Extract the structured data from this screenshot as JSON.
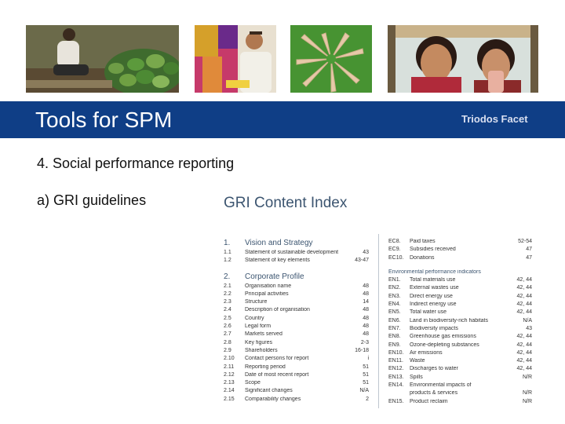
{
  "banner": {
    "title": "Tools for SPM",
    "logo": "Triodos Facet"
  },
  "heading": "4. Social performance reporting",
  "subheading": "a) GRI guidelines",
  "index_title": "GRI Content Index",
  "left_column": [
    {
      "type": "section",
      "num": "1.",
      "label": "Vision and Strategy"
    },
    {
      "num": "1.1",
      "label": "Statement of sustainable development",
      "page": "43"
    },
    {
      "num": "1.2",
      "label": "Statement of key elements",
      "page": "43-47"
    },
    {
      "type": "gap"
    },
    {
      "type": "section",
      "num": "2.",
      "label": "Corporate Profile"
    },
    {
      "num": "2.1",
      "label": "Organisation name",
      "page": "48"
    },
    {
      "num": "2.2",
      "label": "Principal activities",
      "page": "48"
    },
    {
      "num": "2.3",
      "label": "Structure",
      "page": "14"
    },
    {
      "num": "2.4",
      "label": "Description of organisation",
      "page": "48"
    },
    {
      "num": "2.5",
      "label": "Country",
      "page": "48"
    },
    {
      "num": "2.6",
      "label": "Legal form",
      "page": "48"
    },
    {
      "num": "2.7",
      "label": "Markets served",
      "page": "48"
    },
    {
      "num": "2.8",
      "label": "Key figures",
      "page": "2-3"
    },
    {
      "num": "2.9",
      "label": "Shareholders",
      "page": "16-18"
    },
    {
      "num": "2.10",
      "label": "Contact persons for report",
      "page": "i"
    },
    {
      "num": "2.11",
      "label": "Reporting period",
      "page": "51"
    },
    {
      "num": "2.12",
      "label": "Date of most recent report",
      "page": "51"
    },
    {
      "num": "2.13",
      "label": "Scope",
      "page": "51"
    },
    {
      "num": "2.14",
      "label": "Significant changes",
      "page": "N/A"
    },
    {
      "num": "2.15",
      "label": "Comparability changes",
      "page": "2"
    }
  ],
  "right_column": [
    {
      "num": "EC8.",
      "label": "Paid taxes",
      "page": "52-54"
    },
    {
      "num": "EC9.",
      "label": "Subsidies received",
      "page": "47"
    },
    {
      "num": "EC10.",
      "label": "Donations",
      "page": "47"
    },
    {
      "type": "gap"
    },
    {
      "type": "heading",
      "label": "Environmental performance indicators"
    },
    {
      "num": "EN1.",
      "label": "Total materials use",
      "page": "42, 44"
    },
    {
      "num": "EN2.",
      "label": "External wastes use",
      "page": "42, 44"
    },
    {
      "num": "EN3.",
      "label": "Direct energy use",
      "page": "42, 44"
    },
    {
      "num": "EN4.",
      "label": "Indirect energy use",
      "page": "42, 44"
    },
    {
      "num": "EN5.",
      "label": "Total water use",
      "page": "42, 44"
    },
    {
      "num": "EN6.",
      "label": "Land in biodiversity-rich habitats",
      "page": "N/A"
    },
    {
      "num": "EN7.",
      "label": "Biodiversity impacts",
      "page": "43"
    },
    {
      "num": "EN8.",
      "label": "Greenhouse gas emissions",
      "page": "42, 44"
    },
    {
      "num": "EN9.",
      "label": "Ozone-depleting substances",
      "page": "42, 44"
    },
    {
      "num": "EN10.",
      "label": "Air emissions",
      "page": "42, 44"
    },
    {
      "num": "EN11.",
      "label": "Waste",
      "page": "42, 44"
    },
    {
      "num": "EN12.",
      "label": "Discharges to water",
      "page": "42, 44"
    },
    {
      "num": "EN13.",
      "label": "Spills",
      "page": "N/R"
    },
    {
      "num": "EN14.",
      "label": "Environmental impacts of",
      "page": ""
    },
    {
      "num": "",
      "label": "products & services",
      "page": "N/R"
    },
    {
      "num": "EN15.",
      "label": "Product reclaim",
      "page": "N/R"
    }
  ],
  "colors": {
    "banner": "#0f3e86",
    "index_blue": "#3c5570"
  }
}
